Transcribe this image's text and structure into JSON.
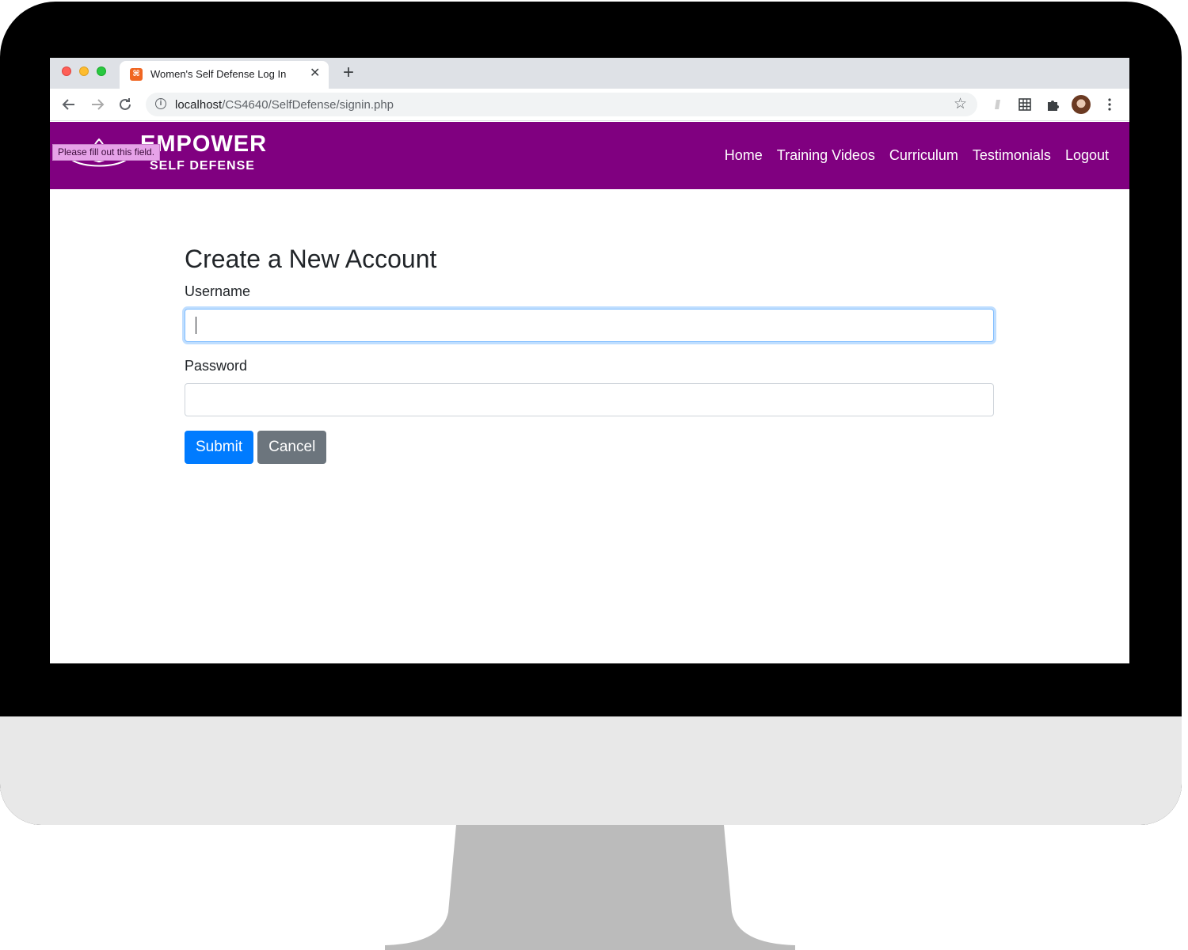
{
  "browser": {
    "tab_title": "Women's Self Defense Log In",
    "tab_close_glyph": "✕",
    "new_tab_glyph": "+",
    "url_host": "localhost",
    "url_path": "/CS4640/SelfDefense/signin.php",
    "icons": [
      "back-icon",
      "forward-icon",
      "reload-icon",
      "info-icon",
      "star-icon",
      "extension-icon",
      "grid-icon",
      "puzzle-icon",
      "avatar",
      "menu-icon"
    ]
  },
  "site": {
    "brand_main": "EMPOWER",
    "brand_sub": "SELF DEFENSE",
    "header_color": "#800080",
    "nav": [
      "Home",
      "Training Videos",
      "Curriculum",
      "Testimonials",
      "Logout"
    ]
  },
  "validation_tooltip": "Please fill out this field.",
  "form": {
    "title": "Create a New Account",
    "username_label": "Username",
    "username_value": "",
    "password_label": "Password",
    "password_value": "",
    "submit_label": "Submit",
    "cancel_label": "Cancel",
    "submit_color": "#007bff",
    "cancel_color": "#6c757d"
  }
}
